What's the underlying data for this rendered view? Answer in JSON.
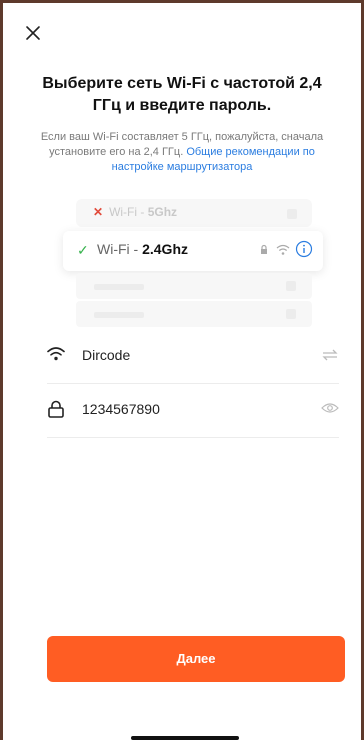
{
  "header": {
    "close_icon": "close-icon"
  },
  "title": "Выберите сеть Wi-Fi с частотой 2,4 ГГц и введите пароль.",
  "description": {
    "text": "Если ваш Wi-Fi составляет 5 ГГц, пожалуйста, сначала установите его на 2,4 ГГц.",
    "link": "Общие рекомендации по настройке маршрутизатора"
  },
  "illustration": {
    "rejected": {
      "prefix": "Wi-Fi - ",
      "band": "5Ghz"
    },
    "selected": {
      "prefix": "Wi-Fi - ",
      "band": "2.4Ghz"
    }
  },
  "network": {
    "ssid": "Dircode",
    "password": "1234567890"
  },
  "actions": {
    "next_label": "Далее"
  },
  "colors": {
    "accent": "#ff5d23",
    "link": "#2b7de0",
    "check": "#37b24d",
    "reject": "#e14b3b"
  }
}
